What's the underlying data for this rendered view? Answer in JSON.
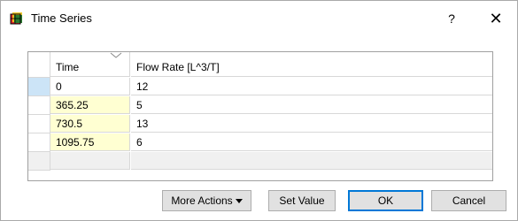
{
  "window": {
    "title": "Time Series",
    "help_label": "?",
    "close_label": "✕"
  },
  "table": {
    "columns": [
      "Time",
      "Flow Rate [L^3/T]"
    ],
    "rows": [
      {
        "time": "0",
        "flow": "12"
      },
      {
        "time": "365.25",
        "flow": "5"
      },
      {
        "time": "730.5",
        "flow": "13"
      },
      {
        "time": "1095.75",
        "flow": "6"
      }
    ]
  },
  "buttons": {
    "more_actions": "More Actions",
    "set_value": "Set Value",
    "ok": "OK",
    "cancel": "Cancel"
  },
  "colors": {
    "selected_row_header": "#cce4f7",
    "fixed_cell": "#ffffd2",
    "default_button_border": "#0078d7"
  }
}
